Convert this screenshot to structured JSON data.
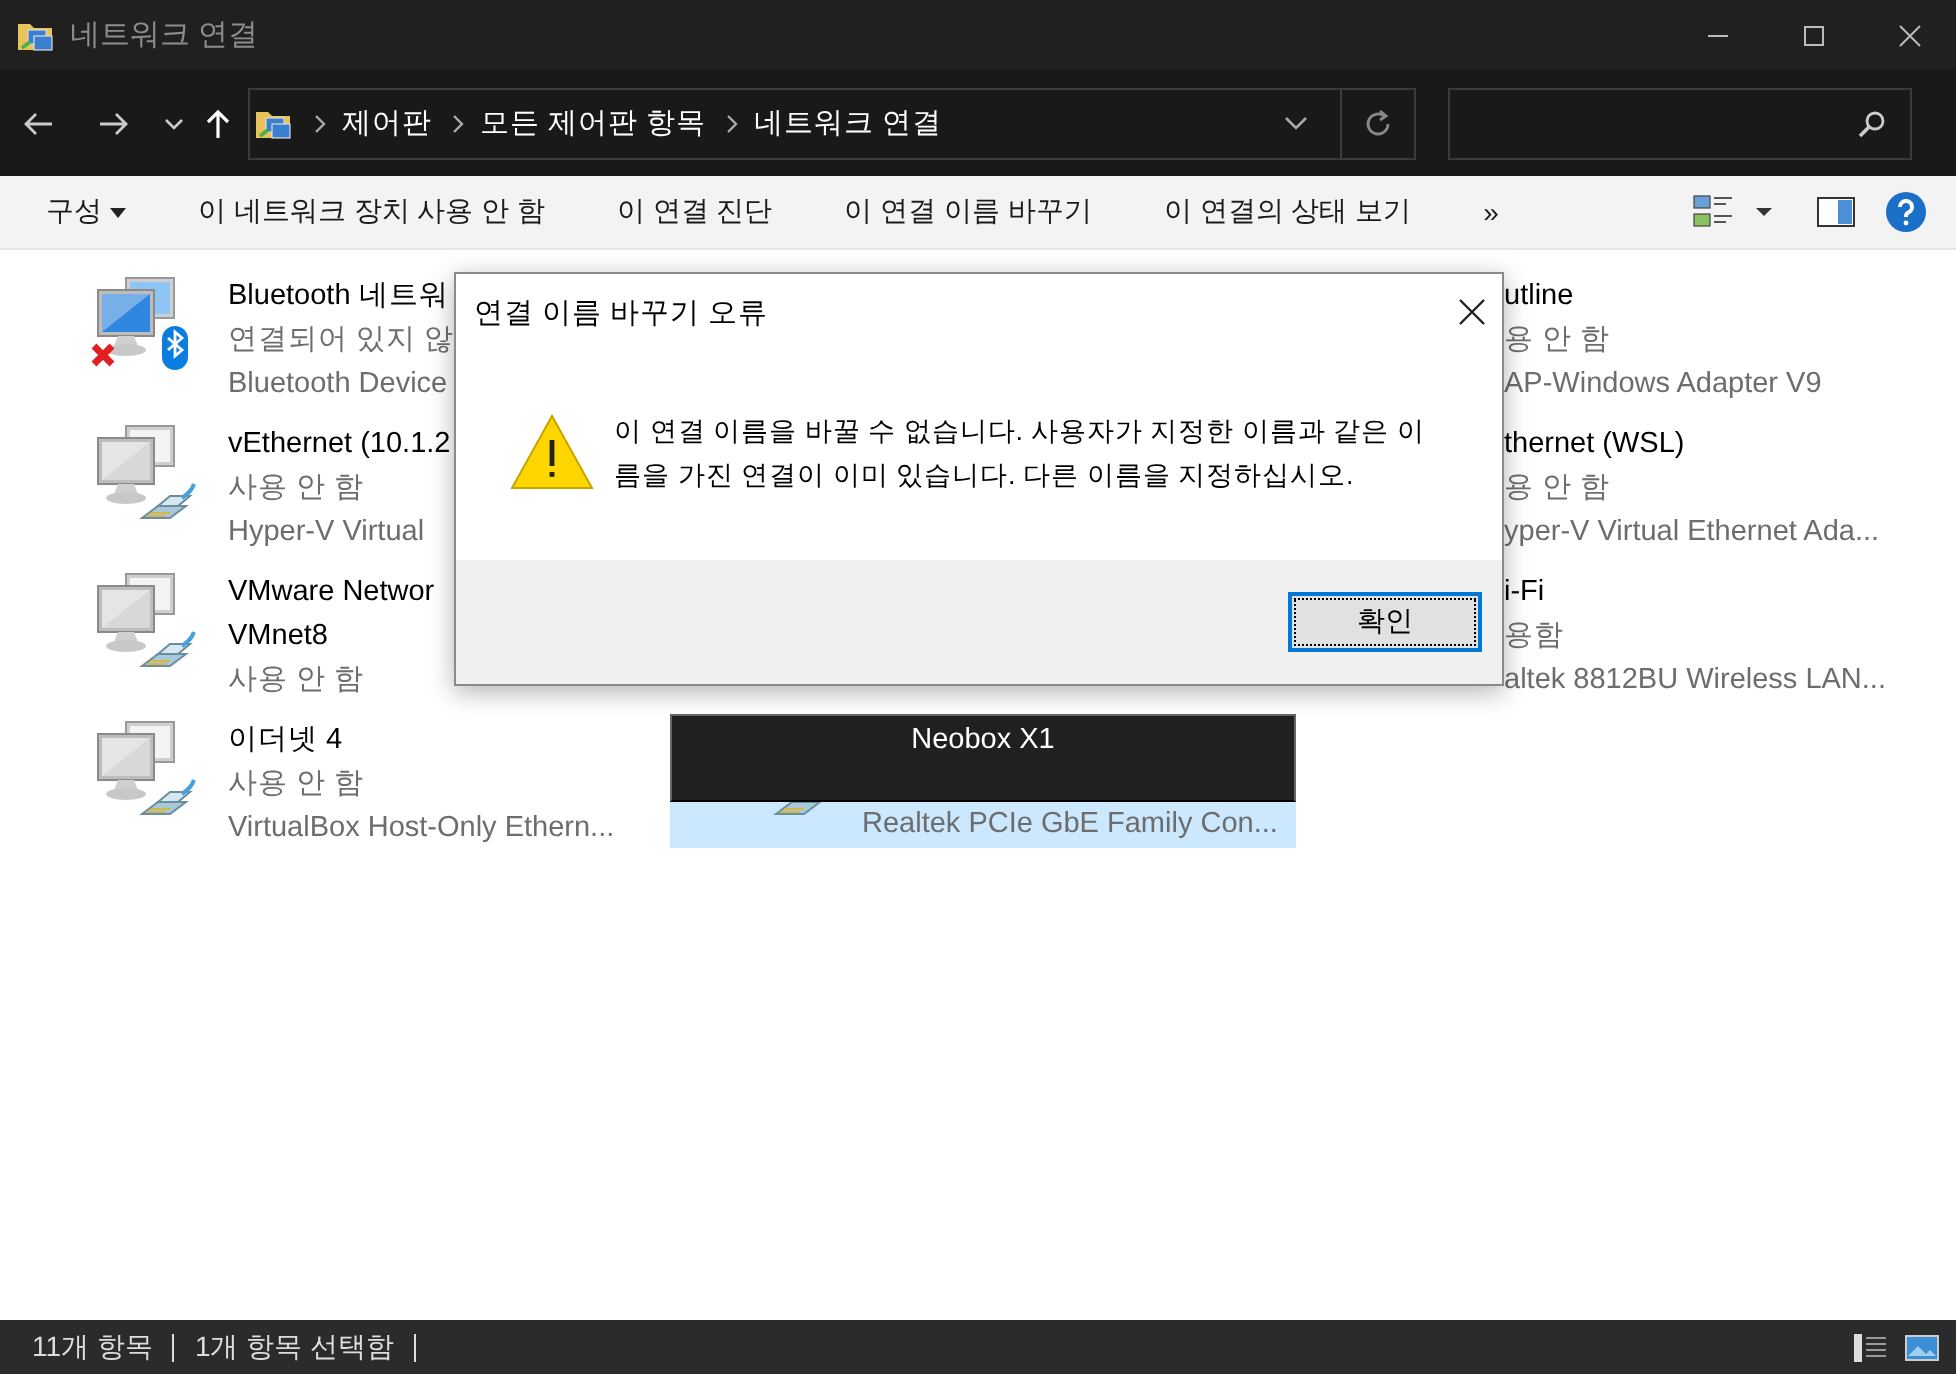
{
  "window": {
    "title": "네트워크 연결"
  },
  "address_bar": {
    "crumbs": [
      "제어판",
      "모든 제어판 항목",
      "네트워크 연결"
    ]
  },
  "toolbar": [
    {
      "label": "구성",
      "kind": "menu"
    },
    {
      "label": "이 네트워크 장치 사용 안 함",
      "kind": "command"
    },
    {
      "label": "이 연결 진단",
      "kind": "command"
    },
    {
      "label": "이 연결 이름 바꾸기",
      "kind": "command"
    },
    {
      "label": "이 연결의 상태 보기",
      "kind": "command"
    },
    {
      "label": "»",
      "kind": "command"
    }
  ],
  "columns": [
    {
      "items": [
        {
          "kind": "bluetooth",
          "selected": false,
          "lines": [
            {
              "text": "Bluetooth 네트워",
              "kind": "name"
            },
            {
              "text": "연결되어 있지 않",
              "kind": "detail"
            },
            {
              "text": "Bluetooth Device",
              "kind": "detail"
            }
          ]
        },
        {
          "kind": "ethernet",
          "selected": false,
          "lines": [
            {
              "text": "vEthernet (10.1.2",
              "kind": "name"
            },
            {
              "text": "사용 안 함",
              "kind": "detail"
            },
            {
              "text": "Hyper-V Virtual",
              "kind": "detail"
            }
          ]
        },
        {
          "kind": "ethernet",
          "selected": false,
          "lines": [
            {
              "text": "VMware Networ",
              "kind": "name"
            },
            {
              "text": "VMnet8",
              "kind": "name"
            },
            {
              "text": "사용 안 함",
              "kind": "detail"
            }
          ]
        },
        {
          "kind": "ethernet",
          "selected": false,
          "lines": [
            {
              "text": "이더넷 4",
              "kind": "name"
            },
            {
              "text": "사용 안 함",
              "kind": "detail"
            },
            {
              "text": "VirtualBox Host-Only Ethern...",
              "kind": "detail"
            }
          ]
        }
      ]
    },
    {
      "items": [
        {
          "kind": "ethernet",
          "selected": true,
          "editing": true,
          "name": "Neobox X1",
          "lines": [
            {
              "text": "Realtek PCIe GbE Family Con...",
              "kind": "detail"
            }
          ]
        }
      ]
    },
    {
      "items": [
        {
          "selected": false,
          "lines": [
            {
              "text": "utline",
              "kind": "name"
            },
            {
              "text": "용 안 함",
              "kind": "detail"
            },
            {
              "text": "AP-Windows Adapter V9",
              "kind": "detail"
            }
          ]
        },
        {
          "selected": false,
          "lines": [
            {
              "text": "thernet (WSL)",
              "kind": "name"
            },
            {
              "text": "용 안 함",
              "kind": "detail"
            },
            {
              "text": "yper-V Virtual Ethernet Ada...",
              "kind": "detail"
            }
          ]
        },
        {
          "selected": false,
          "lines": [
            {
              "text": "i-Fi",
              "kind": "name"
            },
            {
              "text": "용함",
              "kind": "detail"
            },
            {
              "text": "altek 8812BU Wireless LAN...",
              "kind": "detail"
            }
          ]
        }
      ]
    }
  ],
  "dialog": {
    "title": "연결 이름 바꾸기 오류",
    "message_lines": [
      "이 연결 이름을 바꿀 수 없습니다. 사용자가 지정한 이름과 같은 이",
      "름을 가진 연결이 이미 있습니다. 다른 이름을 지정하십시오."
    ],
    "button": {
      "label": "확인",
      "focused": true
    }
  },
  "status_bar": {
    "item_count": "11개 항목",
    "selection": "1개 항목 선택함"
  }
}
